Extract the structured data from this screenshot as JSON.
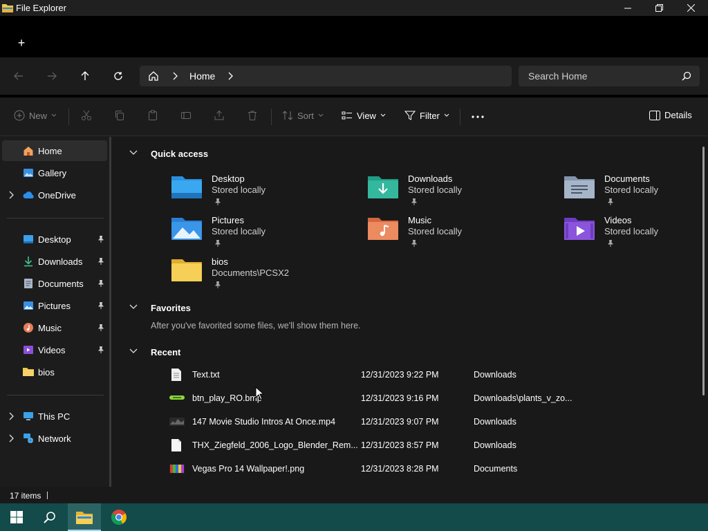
{
  "window": {
    "title": "File Explorer",
    "controls": [
      "minimize",
      "restore",
      "close"
    ]
  },
  "tabs": {
    "new_tab_label": "+"
  },
  "address_bar": {
    "breadcrumb": [
      "Home"
    ],
    "search_placeholder": "Search Home"
  },
  "toolbar": {
    "new_label": "New",
    "sort_label": "Sort",
    "view_label": "View",
    "filter_label": "Filter",
    "details_label": "Details"
  },
  "sidebar": {
    "items": [
      {
        "label": "Home",
        "icon": "home-icon",
        "selected": true
      },
      {
        "label": "Gallery",
        "icon": "gallery-icon"
      },
      {
        "label": "OneDrive",
        "icon": "onedrive-icon",
        "expandable": true
      },
      {
        "label": "Desktop",
        "icon": "desktop-folder-icon",
        "pinned": true
      },
      {
        "label": "Downloads",
        "icon": "download-icon",
        "pinned": true
      },
      {
        "label": "Documents",
        "icon": "documents-icon",
        "pinned": true
      },
      {
        "label": "Pictures",
        "icon": "pictures-icon",
        "pinned": true
      },
      {
        "label": "Music",
        "icon": "music-icon",
        "pinned": true
      },
      {
        "label": "Videos",
        "icon": "videos-icon",
        "pinned": true
      },
      {
        "label": "bios",
        "icon": "folder-icon"
      },
      {
        "label": "This PC",
        "icon": "pc-icon",
        "expandable": true
      },
      {
        "label": "Network",
        "icon": "network-icon",
        "expandable": true
      }
    ]
  },
  "quick_access": {
    "title": "Quick access",
    "items": [
      {
        "name": "Desktop",
        "sub": "Stored locally",
        "icon": "desktop-folder-icon",
        "color": "#3aa0e8"
      },
      {
        "name": "Downloads",
        "sub": "Stored locally",
        "icon": "downloads-folder-icon",
        "color": "#2fb39a"
      },
      {
        "name": "Documents",
        "sub": "Stored locally",
        "icon": "documents-folder-icon",
        "color": "#9aa9c0"
      },
      {
        "name": "Pictures",
        "sub": "Stored locally",
        "icon": "pictures-folder-icon",
        "color": "#3a8fe0"
      },
      {
        "name": "Music",
        "sub": "Stored locally",
        "icon": "music-folder-icon",
        "color": "#e87d5a"
      },
      {
        "name": "Videos",
        "sub": "Stored locally",
        "icon": "videos-folder-icon",
        "color": "#8a4fd6"
      },
      {
        "name": "bios",
        "sub": "Documents\\PCSX2",
        "icon": "folder-icon",
        "color": "#f3c84b"
      }
    ]
  },
  "favorites": {
    "title": "Favorites",
    "empty_message": "After you've favorited some files, we'll show them here."
  },
  "recent": {
    "title": "Recent",
    "rows": [
      {
        "name": "Text.txt",
        "date": "12/31/2023 9:22 PM",
        "location": "Downloads",
        "icon": "text-file-icon"
      },
      {
        "name": "btn_play_RO.bmp",
        "date": "12/31/2023 9:16 PM",
        "location": "Downloads\\plants_v_zo...",
        "icon": "image-file-icon"
      },
      {
        "name": "147 Movie Studio Intros At Once.mp4",
        "date": "12/31/2023 9:07 PM",
        "location": "Downloads",
        "icon": "video-file-icon"
      },
      {
        "name": "THX_Ziegfeld_2006_Logo_Blender_Rem...",
        "date": "12/31/2023 8:57 PM",
        "location": "Downloads",
        "icon": "file-icon"
      },
      {
        "name": "Vegas Pro 14 Wallpaper!.png",
        "date": "12/31/2023 8:28 PM",
        "location": "Documents",
        "icon": "image-file-icon"
      }
    ]
  },
  "status": {
    "item_count": "17 items"
  },
  "taskbar": {
    "items": [
      "start-icon",
      "search-icon",
      "file-explorer-icon",
      "chrome-icon"
    ]
  },
  "colors": {
    "accent": "#4cc2ff",
    "taskbar": "#134a4a",
    "folder_yellow": "#f3c84b"
  }
}
